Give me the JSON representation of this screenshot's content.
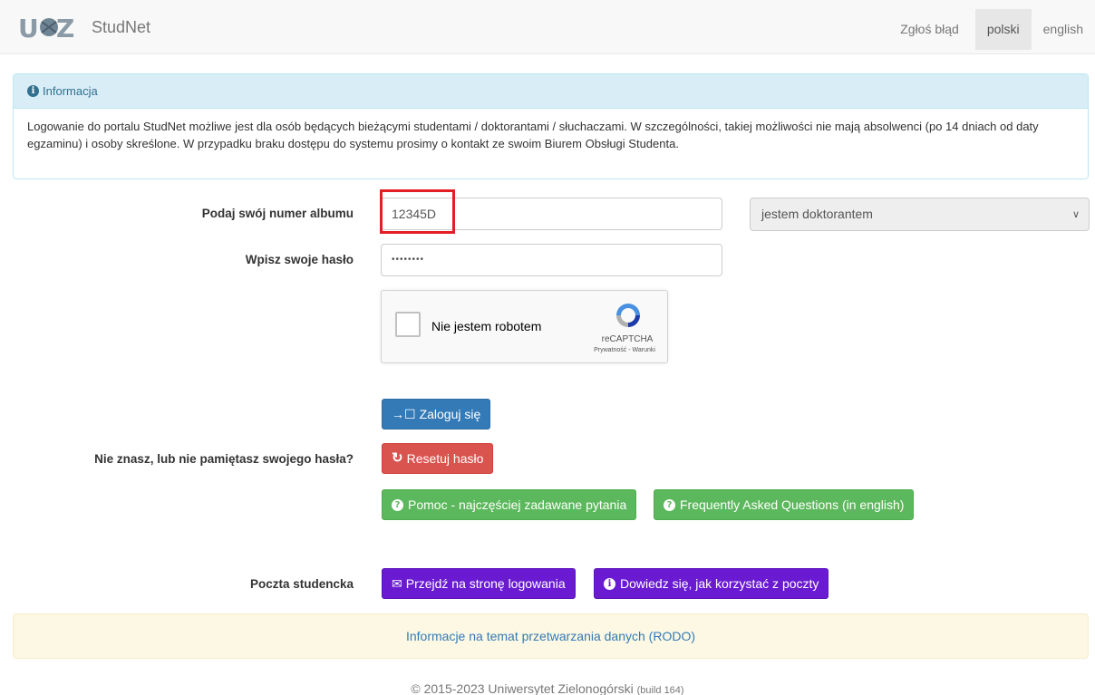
{
  "app": {
    "brand": "StudNet"
  },
  "nav": {
    "report_bug": "Zgłoś błąd",
    "lang_pl": "polski",
    "lang_en": "english"
  },
  "info": {
    "heading": "Informacja",
    "text": "Logowanie do portalu StudNet możliwe jest dla osób będących bieżącymi studentami / doktorantami / słuchaczami. W szczególności, takiej możliwości nie mają absolwenci (po 14 dniach od daty egzaminu) i osoby skreślone. W przypadku braku dostępu do systemu prosimy o kontakt ze swoim Biurem Obsługi Studenta."
  },
  "form": {
    "album_label": "Podaj swój numer albumu",
    "album_value": "12345D",
    "role_value": "jestem doktorantem",
    "password_label": "Wpisz swoje hasło",
    "password_value": "••••••••"
  },
  "captcha": {
    "label": "Nie jestem robotem",
    "brand": "reCAPTCHA",
    "links": "Prywatność - Warunki"
  },
  "buttons": {
    "login": "Zaloguj się",
    "forgot_label": "Nie znasz, lub nie pamiętasz swojego hasła?",
    "reset": "Resetuj hasło",
    "faq_pl": "Pomoc - najczęściej zadawane pytania",
    "faq_en": "Frequently Asked Questions (in english)"
  },
  "mail": {
    "label": "Poczta studencka",
    "goto_login": "Przejdź na stronę logowania",
    "how_to": "Dowiedz się, jak korzystać z poczty"
  },
  "footer": {
    "rodo": "Informacje na temat przetwarzania danych (RODO)",
    "copyright": "© 2015-2023 Uniwersytet Zielonogórski",
    "build": "(build 164)"
  },
  "colors": {
    "primary": "#337ab7",
    "danger": "#d9534f",
    "success": "#5cb85c",
    "mail": "#6a1bd1",
    "highlight": "#e31e24"
  }
}
